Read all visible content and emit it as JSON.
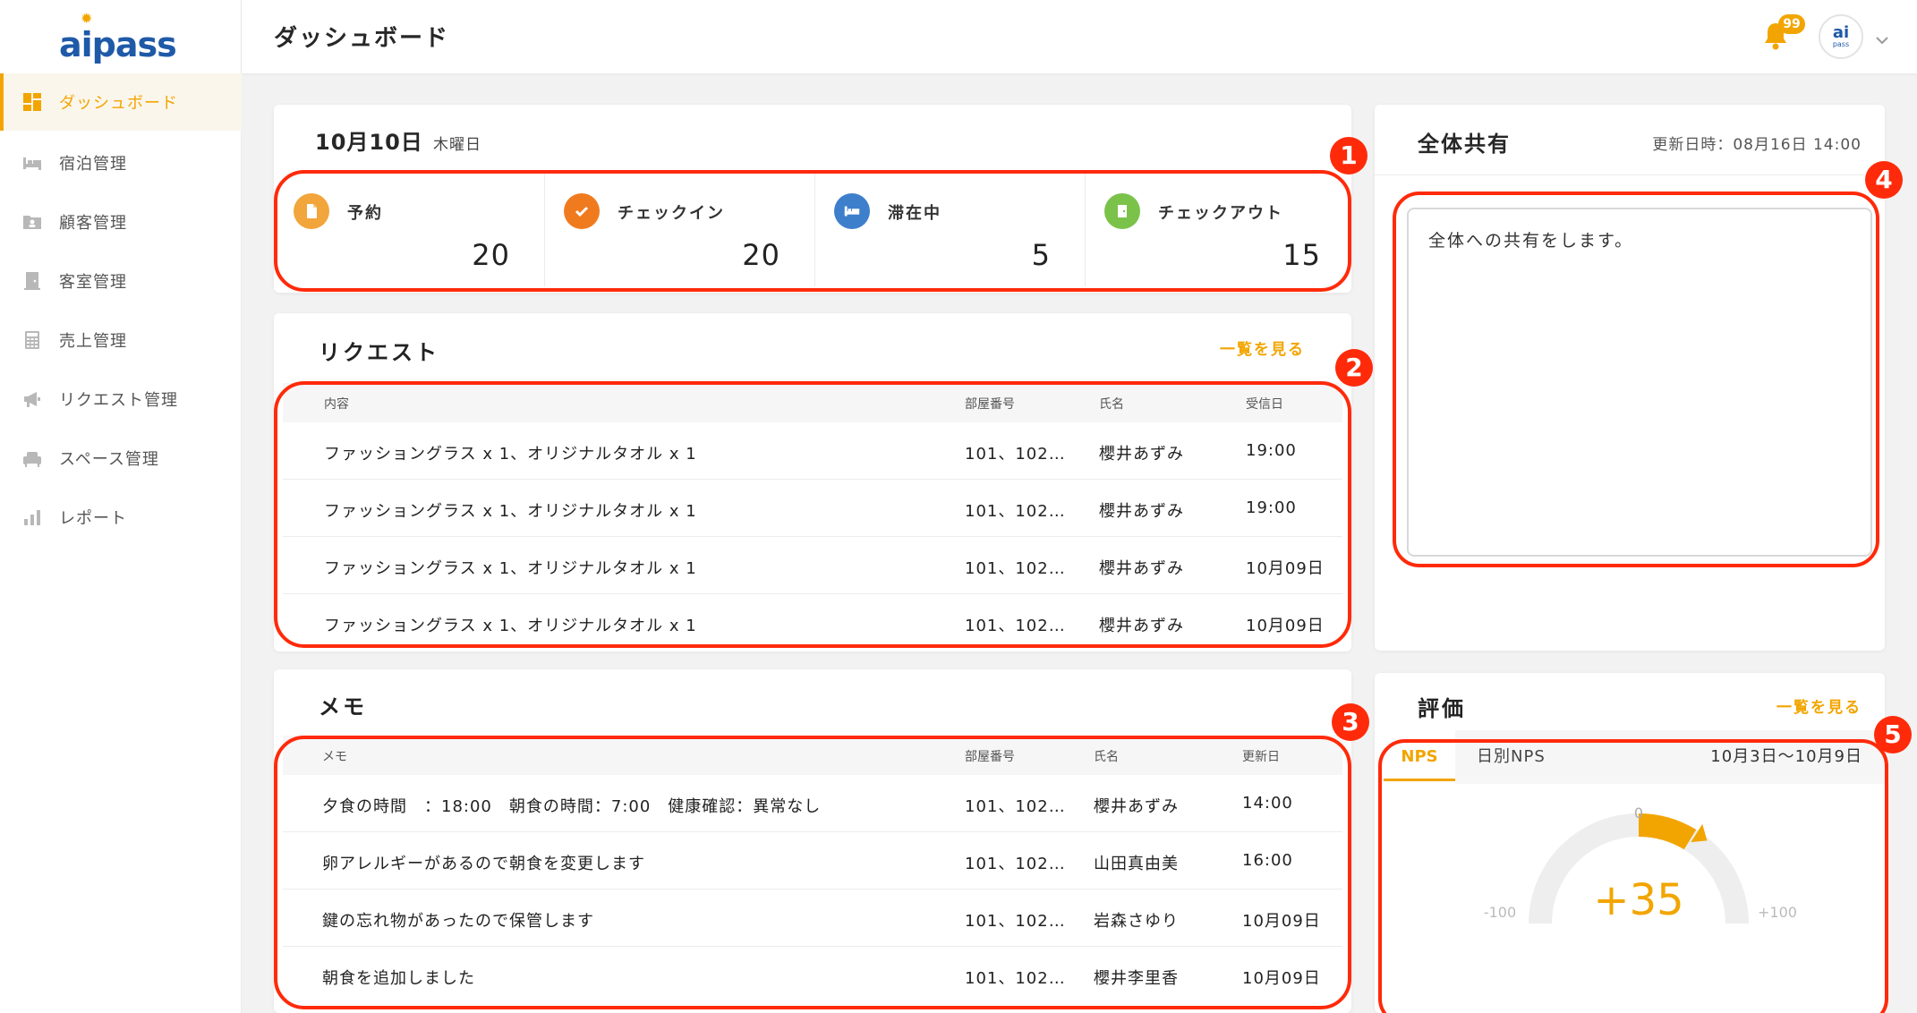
{
  "app": {
    "logo": "aipass",
    "logo_sub": "pass"
  },
  "sidebar": {
    "items": [
      {
        "label": "ダッシュボード",
        "icon": "dashboard-icon",
        "active": true
      },
      {
        "label": "宿泊管理",
        "icon": "bed-icon"
      },
      {
        "label": "顧客管理",
        "icon": "customer-card-icon"
      },
      {
        "label": "客室管理",
        "icon": "door-icon"
      },
      {
        "label": "売上管理",
        "icon": "calculator-icon"
      },
      {
        "label": "リクエスト管理",
        "icon": "megaphone-icon"
      },
      {
        "label": "スペース管理",
        "icon": "sofa-icon"
      },
      {
        "label": "レポート",
        "icon": "bar-chart-icon"
      }
    ]
  },
  "header": {
    "title": "ダッシュボード",
    "notification_count": "99",
    "avatar_text": "ai",
    "avatar_sub": "pass"
  },
  "summary": {
    "date": "10月10日",
    "weekday": "木曜日",
    "stats": [
      {
        "label": "予約",
        "value": "20",
        "icon": "document-icon",
        "color": "#f2a53a"
      },
      {
        "label": "チェックイン",
        "value": "20",
        "icon": "check-icon",
        "color": "#f07b1f"
      },
      {
        "label": "滞在中",
        "value": "5",
        "icon": "bed-icon",
        "color": "#3e7fcc"
      },
      {
        "label": "チェックアウト",
        "value": "15",
        "icon": "exit-door-icon",
        "color": "#7bc24a"
      }
    ]
  },
  "requests": {
    "title": "リクエスト",
    "view_all": "一覧を見る",
    "columns": [
      "内容",
      "部屋番号",
      "氏名",
      "受信日"
    ],
    "rows": [
      [
        "ファッショングラス x 1、オリジナルタオル x 1",
        "101、102…",
        "櫻井あずみ",
        "19:00"
      ],
      [
        "ファッショングラス x 1、オリジナルタオル x 1",
        "101、102…",
        "櫻井あずみ",
        "19:00"
      ],
      [
        "ファッショングラス x 1、オリジナルタオル x 1",
        "101、102…",
        "櫻井あずみ",
        "10月09日"
      ],
      [
        "ファッショングラス x 1、オリジナルタオル x 1",
        "101、102…",
        "櫻井あずみ",
        "10月09日"
      ]
    ]
  },
  "memos": {
    "title": "メモ",
    "columns": [
      "メモ",
      "部屋番号",
      "氏名",
      "更新日"
    ],
    "rows": [
      [
        "夕食の時間　：18:00　朝食の時間：7:00　健康確認：異常なし",
        "101、102…",
        "櫻井あずみ",
        "14:00"
      ],
      [
        "卵アレルギーがあるので朝食を変更します",
        "101、102…",
        "山田真由美",
        "16:00"
      ],
      [
        "鍵の忘れ物があったので保管します",
        "101、102…",
        "岩森さゆり",
        "10月09日"
      ],
      [
        "朝食を追加しました",
        "101、102…",
        "櫻井李里香",
        "10月09日"
      ]
    ]
  },
  "share": {
    "title": "全体共有",
    "updated": "更新日時：08月16日 14:00",
    "text": "全体への共有をします。"
  },
  "rating": {
    "title": "評価",
    "view_all": "一覧を見る",
    "tabs": [
      "NPS",
      "日別NPS"
    ],
    "range": "10月3日〜10月9日",
    "nps_value": "+35",
    "nps": 35,
    "scale_min": "-100",
    "scale_zero": "0",
    "scale_max": "+100"
  },
  "annotations": [
    "1",
    "2",
    "3",
    "4",
    "5"
  ],
  "colors": {
    "accent": "#f2a500",
    "annotation": "#ff2a0a",
    "brand": "#1f5aa8"
  }
}
